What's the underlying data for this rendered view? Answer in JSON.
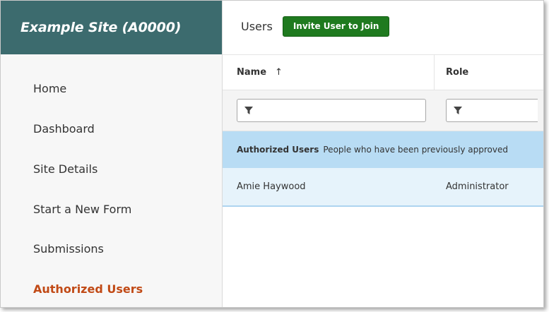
{
  "sidebar": {
    "site_title": "Example Site (A0000)",
    "items": [
      {
        "label": "Home"
      },
      {
        "label": "Dashboard"
      },
      {
        "label": "Site Details"
      },
      {
        "label": "Start a New Form"
      },
      {
        "label": "Submissions"
      },
      {
        "label": "Authorized Users",
        "active": true
      }
    ]
  },
  "main": {
    "title": "Users",
    "invite_button": "Invite User to Join",
    "columns": [
      {
        "label": "Name",
        "sort_indicator": "↑"
      },
      {
        "label": "Role"
      }
    ],
    "group": {
      "name": "Authorized Users",
      "description": "People who have been previously approved"
    },
    "rows": [
      {
        "name": "Amie Haywood",
        "role": "Administrator"
      }
    ]
  },
  "colors": {
    "header_bg": "#3c6b6e",
    "button_bg": "#1f7a1f",
    "active_nav": "#c14a16",
    "group_row_bg": "#b8dcf4",
    "selected_row_bg": "#e6f3fb"
  },
  "icons": {
    "filter": "filter-icon",
    "sort": "arrow-up"
  }
}
